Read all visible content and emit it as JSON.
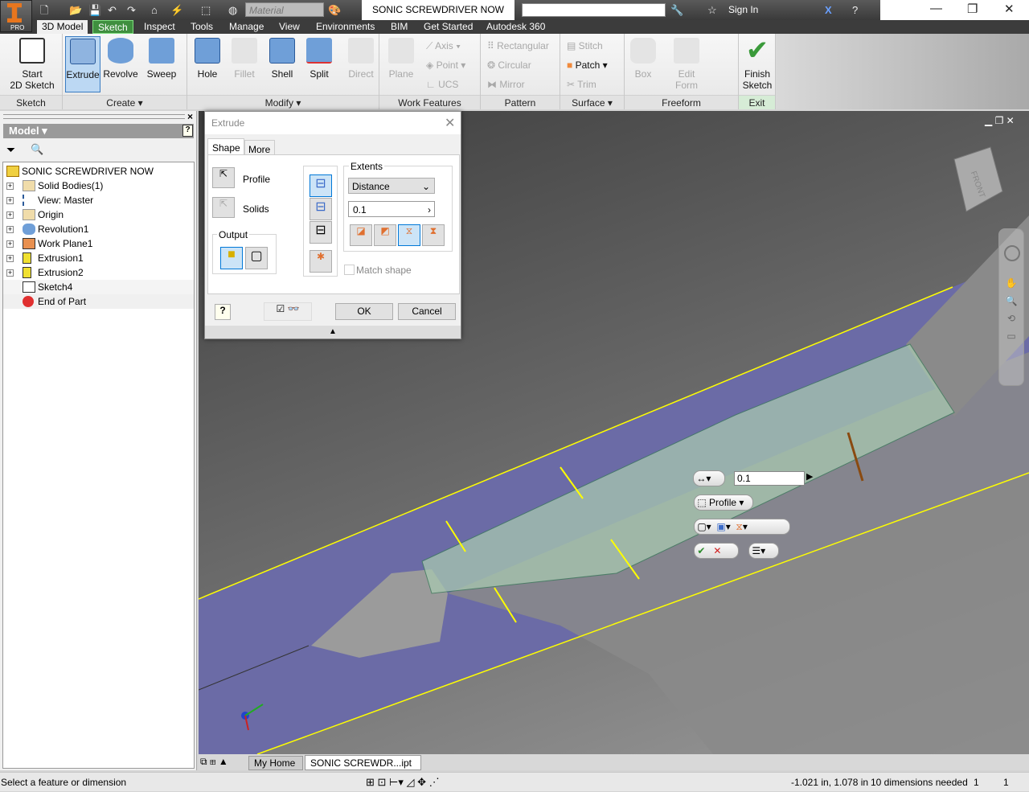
{
  "app": {
    "badge": "PRO",
    "document_title": "SONIC SCREWDRIVER NOW",
    "material_placeholder": "Material",
    "sign_in": "Sign In"
  },
  "ribbon_tabs": [
    "3D Model",
    "Sketch",
    "Inspect",
    "Tools",
    "Manage",
    "View",
    "Environments",
    "BIM",
    "Get Started",
    "Autodesk 360"
  ],
  "ribbon": {
    "sketch": {
      "label": "Sketch",
      "start": "Start",
      "start2": "2D Sketch"
    },
    "create": {
      "label": "Create",
      "extrude": "Extrude",
      "revolve": "Revolve",
      "sweep": "Sweep"
    },
    "modify": {
      "label": "Modify",
      "hole": "Hole",
      "fillet": "Fillet",
      "shell": "Shell",
      "split": "Split",
      "direct": "Direct"
    },
    "work": {
      "label": "Work Features",
      "plane": "Plane",
      "axis": "Axis",
      "point": "Point",
      "ucs": "UCS"
    },
    "pattern": {
      "label": "Pattern",
      "rectangular": "Rectangular",
      "circular": "Circular",
      "mirror": "Mirror"
    },
    "surface": {
      "label": "Surface",
      "stitch": "Stitch",
      "patch": "Patch",
      "trim": "Trim"
    },
    "freeform": {
      "label": "Freeform",
      "box": "Box",
      "edit": "Edit",
      "form": "Form"
    },
    "exit": {
      "label": "Exit",
      "finish": "Finish",
      "finish2": "Sketch"
    }
  },
  "browser": {
    "title": "Model",
    "items": [
      "SONIC SCREWDRIVER NOW",
      "Solid Bodies(1)",
      "View: Master",
      "Origin",
      "Revolution1",
      "Work Plane1",
      "Extrusion1",
      "Extrusion2",
      "Sketch4",
      "End of Part"
    ]
  },
  "dialog": {
    "title": "Extrude",
    "tabs": [
      "Shape",
      "More"
    ],
    "profile": "Profile",
    "solids": "Solids",
    "output": "Output",
    "extents": "Extents",
    "extent_type": "Distance",
    "distance": "0.1",
    "match_shape": "Match shape",
    "ok": "OK",
    "cancel": "Cancel"
  },
  "minitoolbar": {
    "distance": "0.1",
    "profile": "Profile"
  },
  "viewcube": {
    "face": "FRONT"
  },
  "doc_tabs": [
    "My Home",
    "SONIC SCREWDR...ipt"
  ],
  "status": {
    "prompt": "Select a feature or dimension",
    "coords": "-1.021 in, 1.078 in",
    "dims": "10 dimensions needed",
    "n1": "1",
    "n2": "1"
  },
  "colors": {
    "accent": "#3a7cc2",
    "plane": "#6b6ba6",
    "sketch_line": "#ffff00",
    "extrusion": "#9fc4a8"
  }
}
